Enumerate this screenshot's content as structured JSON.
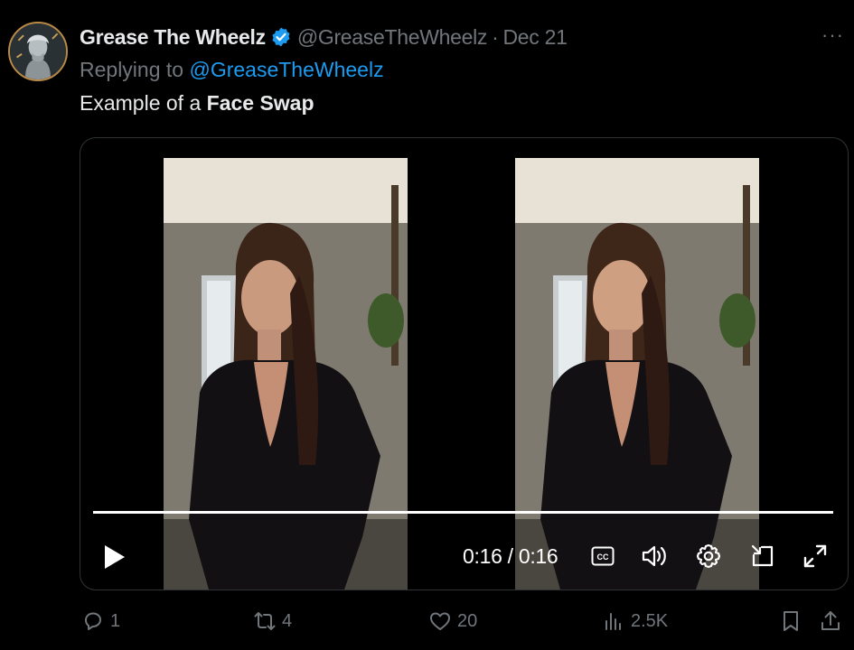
{
  "tweet": {
    "display_name": "Grease The Wheelz",
    "handle": "@GreaseTheWheelz",
    "separator": "·",
    "date": "Dec 21",
    "more": "···",
    "replying_prefix": "Replying to",
    "replying_to": "@GreaseTheWheelz",
    "text_plain": "Example of a",
    "text_bold": "Face Swap"
  },
  "video": {
    "timecode": "0:16 / 0:16",
    "progress_fraction": 1.0,
    "cc_label": "CC"
  },
  "actions": {
    "replies": "1",
    "retweets": "4",
    "likes": "20",
    "views": "2.5K"
  },
  "colors": {
    "background": "#000000",
    "text_primary": "#e7e9ea",
    "text_secondary": "#71767b",
    "accent": "#1d9bf0",
    "verified": "#1d9bf0"
  },
  "icons": [
    "avatar",
    "verified-badge-icon",
    "more-icon",
    "play-icon",
    "cc-icon",
    "volume-icon",
    "settings-gear-icon",
    "picture-in-picture-icon",
    "fullscreen-icon",
    "reply-icon",
    "retweet-icon",
    "like-icon",
    "views-icon",
    "bookmark-icon",
    "share-icon"
  ]
}
